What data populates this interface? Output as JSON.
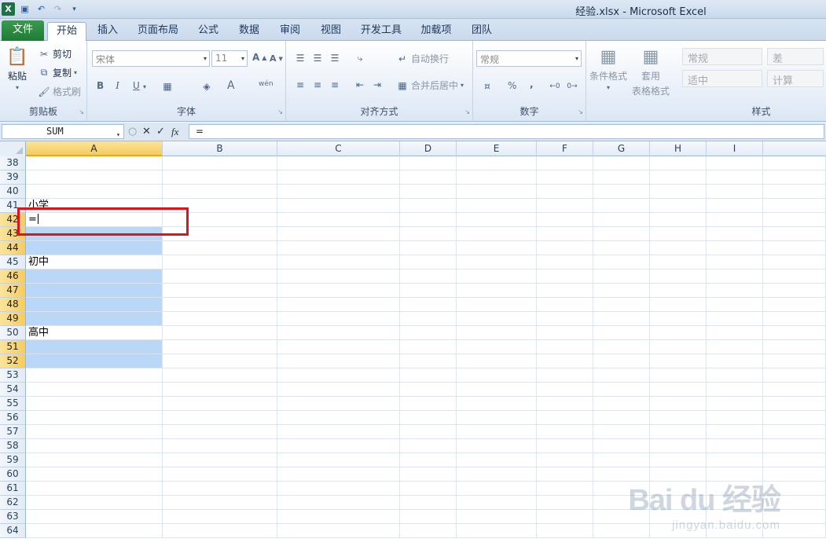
{
  "window": {
    "title": "经验.xlsx - Microsoft Excel"
  },
  "quick_access": [
    "excel-logo",
    "save-icon",
    "undo-icon",
    "redo-icon",
    "customize-icon"
  ],
  "tabs": [
    {
      "label": "文件"
    },
    {
      "label": "开始"
    },
    {
      "label": "插入"
    },
    {
      "label": "页面布局"
    },
    {
      "label": "公式"
    },
    {
      "label": "数据"
    },
    {
      "label": "审阅"
    },
    {
      "label": "视图"
    },
    {
      "label": "开发工具"
    },
    {
      "label": "加载项"
    },
    {
      "label": "团队"
    }
  ],
  "ribbon": {
    "clipboard": {
      "label": "剪贴板",
      "paste": "粘贴",
      "cut": "剪切",
      "copy": "复制",
      "format_painter": "格式刷"
    },
    "font": {
      "label": "字体",
      "font_name": "宋体",
      "font_size": "11",
      "bold": "B",
      "italic": "I",
      "underline": "U",
      "font_color": "A",
      "phonetic": "wén"
    },
    "alignment": {
      "label": "对齐方式",
      "wrap_text": "自动换行",
      "merge_center": "合并后居中"
    },
    "number": {
      "label": "数字",
      "format": "常规",
      "percent": "%",
      "comma": ","
    },
    "styles": {
      "label": "样式",
      "conditional_formatting": "条件格式",
      "format_as_table_1": "套用",
      "format_as_table_2": "表格格式",
      "cell_styles": [
        "常规",
        "差",
        "适中",
        "计算"
      ]
    }
  },
  "formula_bar": {
    "name_box": "SUM",
    "fx": "fx",
    "formula": "="
  },
  "columns": [
    "A",
    "B",
    "C",
    "D",
    "E",
    "F",
    "G",
    "H",
    "I"
  ],
  "rows": [
    {
      "num": "38",
      "a": ""
    },
    {
      "num": "39",
      "a": ""
    },
    {
      "num": "40",
      "a": ""
    },
    {
      "num": "41",
      "a": "小学"
    },
    {
      "num": "42",
      "a": "="
    },
    {
      "num": "43",
      "a": ""
    },
    {
      "num": "44",
      "a": ""
    },
    {
      "num": "45",
      "a": "初中"
    },
    {
      "num": "46",
      "a": ""
    },
    {
      "num": "47",
      "a": ""
    },
    {
      "num": "48",
      "a": ""
    },
    {
      "num": "49",
      "a": ""
    },
    {
      "num": "50",
      "a": "高中"
    },
    {
      "num": "51",
      "a": ""
    },
    {
      "num": "52",
      "a": ""
    },
    {
      "num": "53",
      "a": ""
    },
    {
      "num": "54",
      "a": ""
    },
    {
      "num": "55",
      "a": ""
    },
    {
      "num": "56",
      "a": ""
    },
    {
      "num": "57",
      "a": ""
    },
    {
      "num": "58",
      "a": ""
    },
    {
      "num": "59",
      "a": ""
    },
    {
      "num": "60",
      "a": ""
    },
    {
      "num": "61",
      "a": ""
    },
    {
      "num": "62",
      "a": ""
    },
    {
      "num": "63",
      "a": ""
    },
    {
      "num": "64",
      "a": ""
    }
  ],
  "selection": {
    "selected_rows": [
      "42",
      "43",
      "44",
      "46",
      "47",
      "48",
      "49",
      "51",
      "52"
    ],
    "highlight_rows": [
      "43",
      "44",
      "46",
      "47",
      "48",
      "49",
      "51",
      "52"
    ],
    "active_row": "42",
    "selected_column": "A"
  },
  "watermark": {
    "main": "Bai du 经验",
    "sub": "jingyan.baidu.com"
  }
}
